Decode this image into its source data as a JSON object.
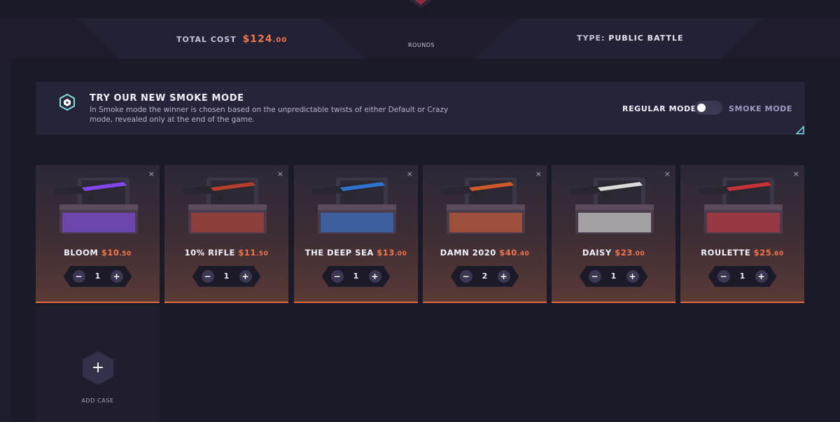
{
  "summary": {
    "total_cost_label": "TOTAL COST",
    "total_cost_dollars": "$124",
    "total_cost_cents": ".00",
    "rounds_label": "ROUNDS",
    "type_label": "TYPE:",
    "type_value": "PUBLIC BATTLE"
  },
  "smoke": {
    "title": "TRY OUR NEW SMOKE MODE",
    "description": "In Smoke mode the winner is chosen based on the unpredictable twists of either Default or Crazy mode, revealed only at the end of the game.",
    "regular_label": "REGULAR MODE",
    "smoke_label": "SMOKE MODE",
    "toggle_on": false
  },
  "cases": [
    {
      "name": "BLOOM",
      "price": "$10",
      "cents": ".50",
      "qty": "1",
      "accent": "#8a4cff"
    },
    {
      "name": "10% RIFLE",
      "price": "$11",
      "cents": ".50",
      "qty": "1",
      "accent": "#c2412c"
    },
    {
      "name": "THE DEEP SEA",
      "price": "$13",
      "cents": ".00",
      "qty": "1",
      "accent": "#2f7de0"
    },
    {
      "name": "DAMN 2020",
      "price": "$40",
      "cents": ".40",
      "qty": "2",
      "accent": "#e0602c"
    },
    {
      "name": "DAISY",
      "price": "$23",
      "cents": ".00",
      "qty": "1",
      "accent": "#f0f0f0"
    },
    {
      "name": "ROULETTE",
      "price": "$25",
      "cents": ".60",
      "qty": "1",
      "accent": "#d8343a"
    }
  ],
  "controls": {
    "minus": "−",
    "plus": "+",
    "close": "×"
  },
  "add_case": {
    "label": "ADD CASE",
    "icon": "+"
  }
}
